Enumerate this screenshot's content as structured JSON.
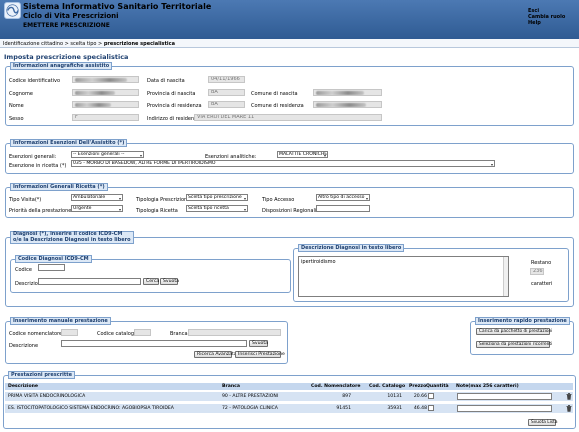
{
  "header": {
    "title": "Sistema Informativo Sanitario Territoriale",
    "subtitle": "Ciclo di Vita Prescrizioni",
    "section": "EMETTERE PRESCRIZIONE",
    "links": [
      "Esci",
      "Cambia ruolo",
      "Help"
    ]
  },
  "breadcrumb": {
    "items": [
      "Identificazione cittadino",
      "scelta tipo"
    ],
    "separator": ">",
    "current": "prescrizione specialistica"
  },
  "page_title": "Imposta prescrizione specialistica",
  "anagrafica": {
    "legend": "Informazioni anagrafiche assistito",
    "codice_label": "Codice identificativo",
    "cognome_label": "Cognome",
    "nome_label": "Nome",
    "sesso_label": "Sesso",
    "sesso_value": "F",
    "data_nascita_label": "Data di nascita",
    "data_nascita_value": "04/11/1966",
    "prov_nascita_label": "Provincia di nascita",
    "prov_nascita_value": "BA",
    "prov_res_label": "Provincia di residenza",
    "prov_res_value": "BA",
    "indirizzo_label": "Indirizzo di residenza",
    "indirizzo_value": "VIA EROI DEL MARE 11",
    "comune_nascita_label": "Comune di nascita",
    "comune_res_label": "Comune di residenza"
  },
  "esenzioni": {
    "legend": "Informazioni Esenzioni Dell'Assistito (*)",
    "generali_label": "Esenzioni generali:",
    "generali_value": "-- Esenzioni generali --",
    "analitiche_label": "Esenzioni analitiche:",
    "analitiche_value": "MALATTIE CRONICHE",
    "ricetta_label": "Esenzione in ricetta (*)",
    "ricetta_value": "035 - MORBO DI BASEDOW, ALTRE FORME DI IPERTIROIDISMO"
  },
  "ricetta": {
    "legend": "Informazioni Generali Ricetta (*)",
    "tipo_visita_label": "Tipo Visita(*)",
    "tipo_visita_value": "Ambulatoriale",
    "priorita_label": "Priorità della prestazione",
    "priorita_value": "Urgente",
    "tip_prescrizione_label": "Tipologia Prescrizione",
    "tip_prescrizione_value": "Scelta tipo prescrizione",
    "tip_ricetta_label": "Tipologia Ricetta",
    "tip_ricetta_value": "Scelta tipo ricetta",
    "tipo_accesso_label": "Tipo Accesso",
    "tipo_accesso_value": "Altro tipo di accesso",
    "disposizioni_label": "Disposizioni Regionali"
  },
  "diagnosi": {
    "legend_line1": "Diagnosi (*), inserire il codice ICD9-CM",
    "legend_line2": "o/e la Descrizione Diagnosi in testo libero",
    "icd_legend": "Codice Diagnosi ICD9-CM",
    "codice_label": "Codice",
    "descrizione_label": "Descrizione",
    "cerca": "Cerca",
    "svuota": "Svuota",
    "libero_legend": "Descrizione Diagnosi in testo libero",
    "libero_text": "ipertiroidismo",
    "restano_label": "Restano",
    "restano_value": "236",
    "caratteri_label": "caratteri"
  },
  "manuale": {
    "legend": "Inserimento manuale prestazione",
    "codice_nom_label": "Codice nomenclatore",
    "codice_cat_label": "Codice catalogo",
    "branca_label": "Branca:",
    "descrizione_label": "Descrizione",
    "svuota": "Svuota",
    "ricerca": "Ricerca Avanzata",
    "inserisci": "Inserisci Prestazione"
  },
  "rapido": {
    "legend": "Inserimento rapido prestazione",
    "carica": "Carica da pacchetto di prestazioni",
    "seleziona": "Seleziona da prestazioni ricorrenti"
  },
  "prestazioni": {
    "legend": "Prestazioni prescritte",
    "headers": [
      "Descrizione",
      "Branca",
      "Cod. Nomenclatore",
      "Cod. Catalogo",
      "Prezzo",
      "Quantità",
      "Note(max 256 caratteri)"
    ],
    "rows": [
      {
        "descrizione": "PRIMA VISITA ENDOCRINOLOGICA",
        "branca": "90 - ALTRE PRESTAZIONI",
        "nomenclatore": "897",
        "catalogo": "10131",
        "prezzo": "20.66"
      },
      {
        "descrizione": "ES. ISTOCITOPATOLOGICO SISTEMA ENDOCRINO: AGOBIOPSIA TIROIDEA",
        "branca": "72 - PATOLOGIA CLINICA",
        "nomenclatore": "91451",
        "catalogo": "35931",
        "prezzo": "46.48"
      }
    ],
    "svuota_lista": "Svuota Lista"
  },
  "colors": {
    "header": "#3f6aa4",
    "legend_bg": "#dce8f6",
    "row_bg": "#d6e3f3",
    "border": "#7ea1cc"
  }
}
